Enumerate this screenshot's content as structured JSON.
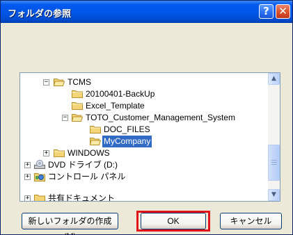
{
  "window": {
    "title": "フォルダの参照",
    "help_label": "?",
    "close_label": "✕"
  },
  "tree": {
    "items": [
      {
        "label": "TCMS",
        "expander": "⊟",
        "icon": "open-folder-icon",
        "selected": false
      },
      {
        "label": "20100401-BackUp",
        "expander": "",
        "icon": "folder-icon",
        "selected": false
      },
      {
        "label": "Excel_Template",
        "expander": "",
        "icon": "folder-icon",
        "selected": false
      },
      {
        "label": "TOTO_Customer_Management_System",
        "expander": "⊟",
        "icon": "open-folder-icon",
        "selected": false
      },
      {
        "label": "DOC_FILES",
        "expander": "",
        "icon": "folder-icon",
        "selected": false
      },
      {
        "label": "MyCompany",
        "expander": "",
        "icon": "open-folder-icon",
        "selected": true
      },
      {
        "label": "WINDOWS",
        "expander": "⊞",
        "icon": "folder-icon",
        "selected": false
      },
      {
        "label": "DVD ドライブ (D:)",
        "expander": "⊞",
        "icon": "dvd-drive-icon",
        "selected": false
      },
      {
        "label": "コントロール パネル",
        "expander": "⊞",
        "icon": "control-panel-icon",
        "selected": false
      },
      {
        "label": "共有ドキュメント",
        "expander": "⊞",
        "icon": "shared-folder-icon",
        "selected": false
      }
    ],
    "scroll_up": "▲",
    "scroll_down": "▼"
  },
  "buttons": {
    "new_folder": "新しいフォルダの作成(M)",
    "ok": "OK",
    "cancel": "キャンセル"
  },
  "colors": {
    "title_bar": "#0055e5",
    "selection": "#316ac5",
    "highlight_box": "#e0121a"
  }
}
